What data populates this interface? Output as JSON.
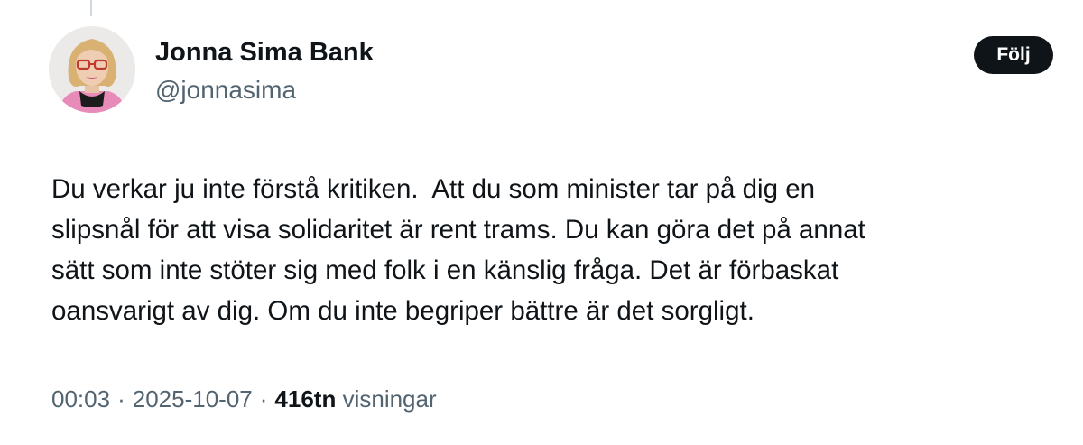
{
  "author": {
    "display_name": "Jonna Sima Bank",
    "handle": "@jonnasima",
    "avatar_icon": "profile-photo"
  },
  "follow_button": {
    "label": "Följ"
  },
  "tweet": {
    "lines": [
      "Du verkar ju inte förstå kritiken.  Att du som minister tar på dig en",
      "slipsnål för att visa solidaritet är rent trams. Du kan göra det på annat",
      "sätt som inte stöter sig med folk i en känslig fråga. Det är förbaskat",
      "oansvarigt av dig. Om du inte begriper bättre är det sorgligt."
    ]
  },
  "meta": {
    "time": "00:03",
    "separator": "·",
    "date": "2025-10-07",
    "views_count": "416tn",
    "views_label": "visningar"
  },
  "colors": {
    "text_primary": "#0f1419",
    "text_secondary": "#536471",
    "button_bg": "#0f1419",
    "button_text": "#ffffff",
    "thread_line": "#cfd9de"
  }
}
